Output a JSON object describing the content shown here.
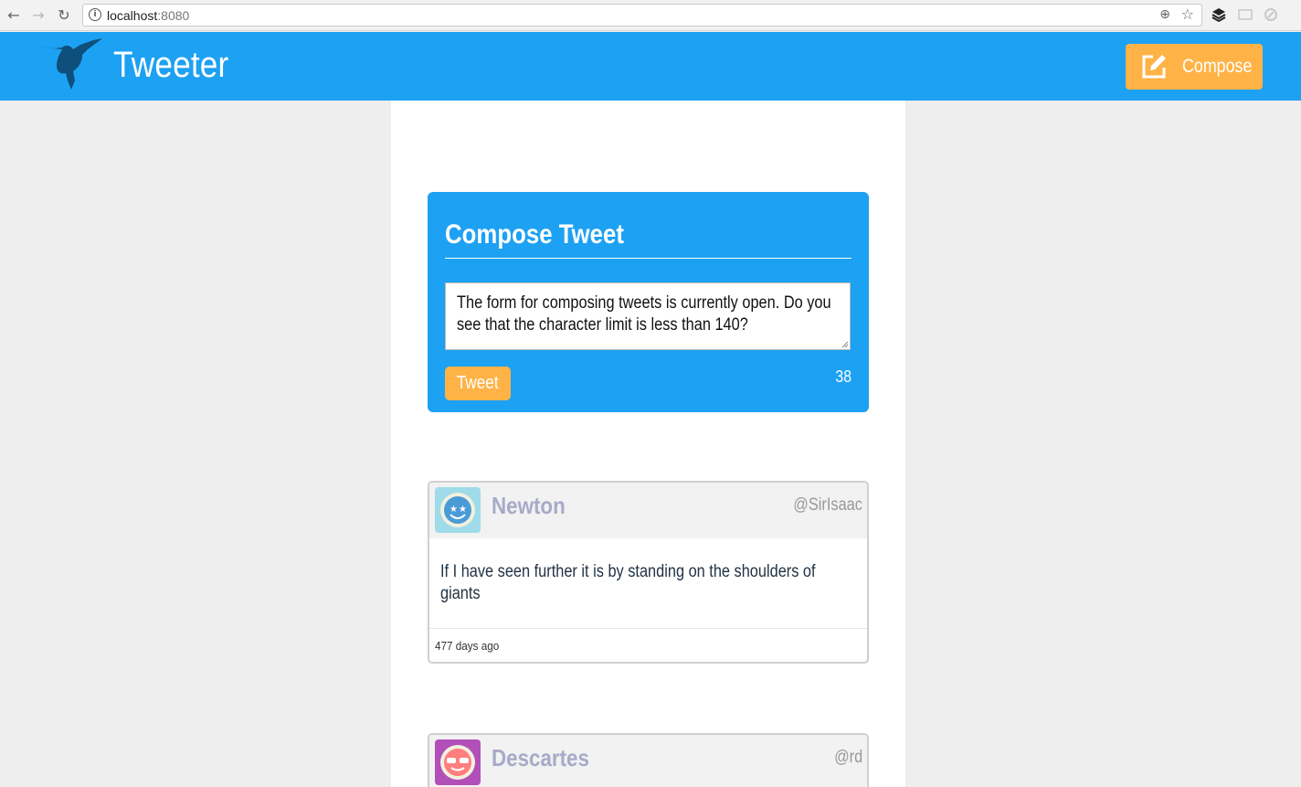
{
  "browser": {
    "url_host": "localhost",
    "url_port": ":8080"
  },
  "header": {
    "title": "Tweeter",
    "compose_label": "Compose",
    "logo_icon": "hummingbird-icon",
    "compose_icon": "edit-icon"
  },
  "compose": {
    "title": "Compose Tweet",
    "text": "The form for composing tweets is currently open. Do you see that the character limit is less than 140?",
    "tweet_label": "Tweet",
    "char_count": "38"
  },
  "tweets": [
    {
      "name": "Newton",
      "handle": "@SirIsaac",
      "text": "If I have seen further it is by standing on the shoulders of giants",
      "time": "477 days ago"
    },
    {
      "name": "Descartes",
      "handle": "@rd",
      "text": "",
      "time": ""
    }
  ],
  "colors": {
    "brand_blue": "#1da1f2",
    "accent_orange": "#ffb347",
    "name_purple": "#a8aac8"
  }
}
